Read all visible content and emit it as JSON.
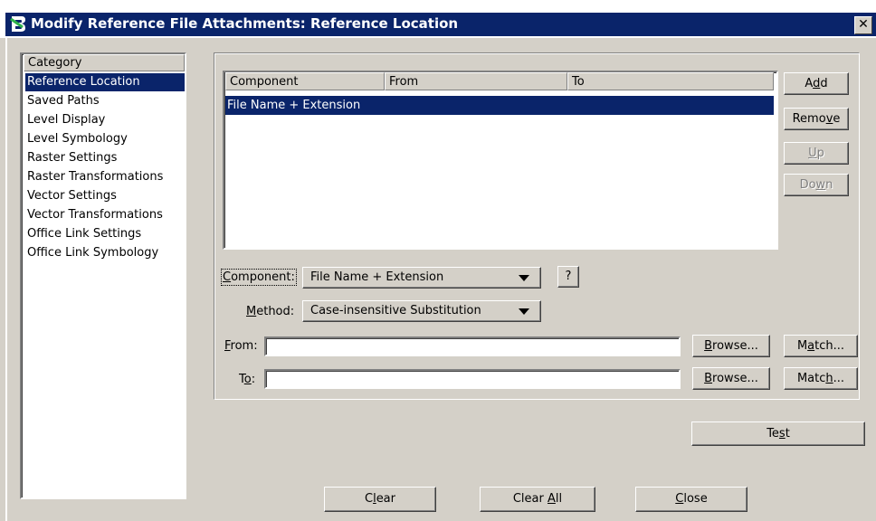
{
  "window": {
    "title": "Modify Reference File Attachments: Reference Location",
    "close_glyph": "✕",
    "app_icon": "bentley-b-icon"
  },
  "category": {
    "header": "Category",
    "items": [
      {
        "label": "Reference Location",
        "selected": true
      },
      {
        "label": "Saved Paths"
      },
      {
        "label": "Level Display"
      },
      {
        "label": "Level Symbology"
      },
      {
        "label": "Raster Settings"
      },
      {
        "label": "Raster Transformations"
      },
      {
        "label": "Vector Settings"
      },
      {
        "label": "Vector Transformations"
      },
      {
        "label": "Office Link Settings"
      },
      {
        "label": "Office Link Symbology"
      }
    ]
  },
  "table": {
    "columns": [
      "Component",
      "From",
      "To"
    ],
    "rows": [
      {
        "component": "File Name + Extension",
        "from": "",
        "to": ""
      }
    ]
  },
  "side_buttons": {
    "add": {
      "pre": "A",
      "key": "d",
      "post": "d"
    },
    "remove": {
      "pre": "Remo",
      "key": "v",
      "post": "e"
    },
    "up": {
      "pre": "",
      "key": "U",
      "post": "p"
    },
    "down": {
      "pre": "Do",
      "key": "w",
      "post": "n"
    }
  },
  "form": {
    "component_label": {
      "pre": "",
      "key": "C",
      "post": "omponent:"
    },
    "component_value": "File Name + Extension",
    "help_label": "?",
    "method_label": {
      "pre": "",
      "key": "M",
      "post": "ethod:"
    },
    "method_value": "Case-insensitive Substitution",
    "from_label": {
      "pre": "",
      "key": "F",
      "post": "rom:"
    },
    "from_value": "",
    "to_label": {
      "pre": "T",
      "key": "o",
      "post": ":"
    },
    "to_value": "",
    "browse_label": {
      "pre": "",
      "key": "B",
      "post": "rowse..."
    },
    "match1_label": {
      "pre": "M",
      "key": "a",
      "post": "tch..."
    },
    "match2_label": {
      "pre": "Matc",
      "key": "h",
      "post": "..."
    }
  },
  "footer": {
    "test": {
      "pre": "Te",
      "key": "s",
      "post": "t"
    },
    "clear": {
      "pre": "C",
      "key": "l",
      "post": "ear"
    },
    "clear_all": {
      "pre": "Clear ",
      "key": "A",
      "post": "ll"
    },
    "close": {
      "pre": "",
      "key": "C",
      "post": "lose"
    }
  }
}
